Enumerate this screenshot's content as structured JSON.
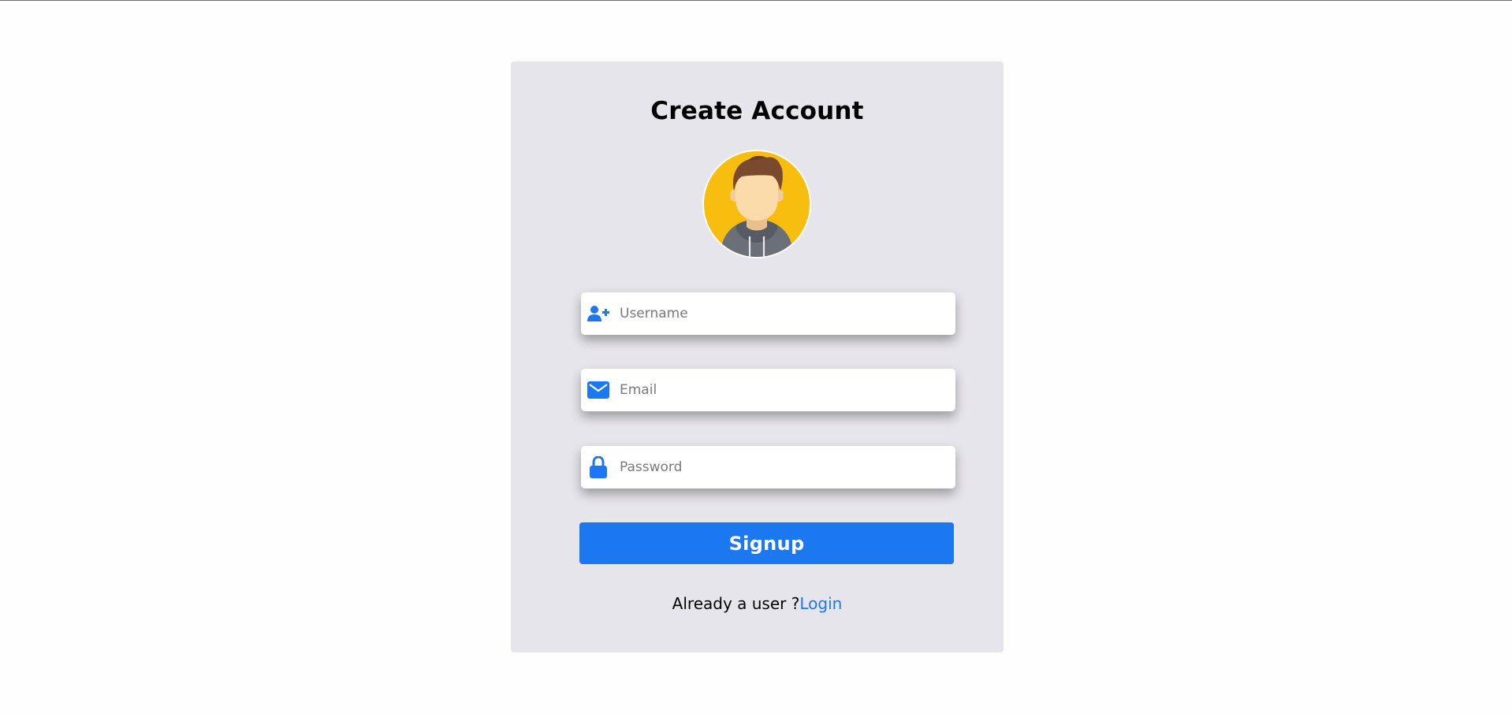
{
  "form": {
    "title": "Create Account",
    "avatar_icon": "user-avatar-icon",
    "fields": {
      "username": {
        "placeholder": "Username",
        "value": "",
        "icon": "user-plus-icon"
      },
      "email": {
        "placeholder": "Email",
        "value": "",
        "icon": "envelope-icon"
      },
      "password": {
        "placeholder": "Password",
        "value": "",
        "icon": "lock-icon"
      }
    },
    "signup_label": "Signup",
    "footer_text": "Already a user ?",
    "login_link": "Login"
  },
  "colors": {
    "accent": "#1c78f0",
    "card_background": "#e6e5eb",
    "avatar_background": "#f7bd0f"
  }
}
